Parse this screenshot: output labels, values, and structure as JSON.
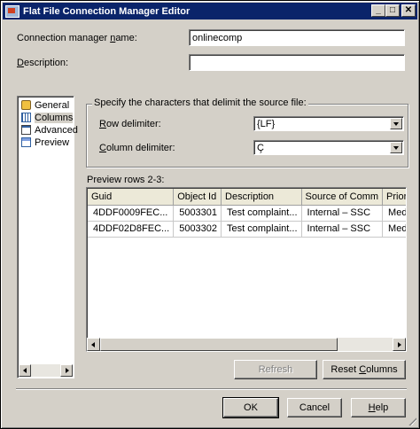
{
  "window": {
    "title": "Flat File Connection Manager Editor"
  },
  "form": {
    "name_label_pre": "Connection manager ",
    "name_label_u": "n",
    "name_label_post": "ame:",
    "name_value": "onlinecomp",
    "desc_label_u": "D",
    "desc_label_post": "escription:",
    "desc_value": ""
  },
  "nav": {
    "items": [
      {
        "label": "General",
        "icon": "general-icon"
      },
      {
        "label": "Columns",
        "icon": "columns-icon",
        "selected": true
      },
      {
        "label": "Advanced",
        "icon": "advanced-icon"
      },
      {
        "label": "Preview",
        "icon": "preview-icon"
      }
    ]
  },
  "delimiters": {
    "group_title": "Specify the characters that delimit the source file:",
    "row_label_u": "R",
    "row_label_post": "ow delimiter:",
    "row_value": "{LF}",
    "col_label_u": "C",
    "col_label_post": "olumn delimiter:",
    "col_value": "Ç"
  },
  "preview": {
    "label": "Preview rows 2-3:",
    "columns": [
      "Guid",
      "Object Id",
      "Description",
      "Source of Comm",
      "Priori"
    ],
    "rows": [
      [
        "4DDF0009FEC...",
        "5003301",
        "Test complaint...",
        "Internal – SSC",
        "Medi"
      ],
      [
        "4DDF02D8FEC...",
        "5003302",
        "Test complaint...",
        "Internal – SSC",
        "Medi"
      ]
    ]
  },
  "buttons": {
    "refresh": "Refresh",
    "reset_pre": "Reset ",
    "reset_u": "C",
    "reset_post": "olumns",
    "ok": "OK",
    "cancel": "Cancel",
    "help_u": "H",
    "help_post": "elp"
  }
}
